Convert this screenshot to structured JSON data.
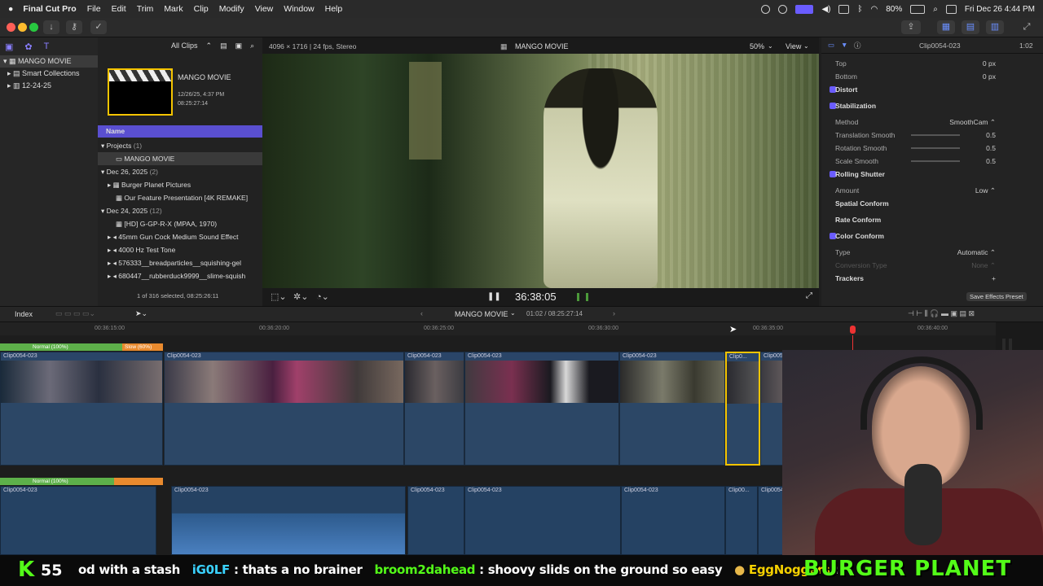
{
  "menubar": {
    "app_name": "Final Cut Pro",
    "items": [
      "File",
      "Edit",
      "Trim",
      "Mark",
      "Clip",
      "Modify",
      "View",
      "Window",
      "Help"
    ],
    "battery": "80%",
    "datetime": "Fri Dec 26  4:44 PM"
  },
  "sidebar": {
    "library": "MANGO MOVIE",
    "items": [
      "Smart Collections",
      "12-24-25"
    ]
  },
  "browser": {
    "filter": "All Clips",
    "project_name": "MANGO MOVIE",
    "project_date": "12/26/25, 4:37 PM",
    "project_duration": "08:25:27:14",
    "name_header": "Name",
    "groups": [
      {
        "label": "Projects",
        "count": "(1)"
      },
      {
        "label": "Dec 26, 2025",
        "count": "(2)"
      },
      {
        "label": "Dec 24, 2025",
        "count": "(12)"
      }
    ],
    "rows": [
      "MANGO MOVIE",
      "Burger Planet Pictures",
      "Our Feature Presentation [4K REMAKE]",
      "[HD] G-GP-R-X (MPAA, 1970)",
      "45mm Gun Cock Medium Sound Effect",
      "4000 Hz Test Tone",
      "576333__breadparticles__squishing-gel",
      "680447__rubberduck9999__slime-squish"
    ],
    "status": "1 of 316 selected, 08:25:26:11"
  },
  "viewer": {
    "format": "4096 × 1716 | 24 fps, Stereo",
    "title": "MANGO MOVIE",
    "zoom": "50%",
    "view_label": "View",
    "timecode": "36:38:05"
  },
  "inspector": {
    "clip_name": "Clip0054-023",
    "duration": "1:02",
    "rows": [
      {
        "label": "Top",
        "value": "0  px",
        "indent": true
      },
      {
        "label": "Bottom",
        "value": "0  px",
        "indent": true
      },
      {
        "label": "Distort",
        "value": "",
        "check": true
      },
      {
        "label": "Stabilization",
        "value": "",
        "check": true
      },
      {
        "label": "Method",
        "value": "SmoothCam ⌃",
        "indent": true
      },
      {
        "label": "Translation Smooth",
        "value": "0.5",
        "indent": true,
        "slider": true
      },
      {
        "label": "Rotation Smooth",
        "value": "0.5",
        "indent": true,
        "slider": true
      },
      {
        "label": "Scale Smooth",
        "value": "0.5",
        "indent": true,
        "slider": true
      },
      {
        "label": "Rolling Shutter",
        "value": "",
        "check": true
      },
      {
        "label": "Amount",
        "value": "Low ⌃",
        "indent": true
      },
      {
        "label": "Spatial Conform",
        "value": "",
        "check": false
      },
      {
        "label": "Rate Conform",
        "value": "",
        "check": false
      },
      {
        "label": "Color Conform",
        "value": "",
        "check": true
      },
      {
        "label": "Type",
        "value": "Automatic ⌃",
        "indent": true
      },
      {
        "label": "Conversion Type",
        "value": "None ⌃",
        "indent": true,
        "dim": true
      },
      {
        "label": "Trackers",
        "value": "+",
        "check": false
      }
    ],
    "save_preset": "Save Effects Preset"
  },
  "timeline": {
    "index_label": "Index",
    "project": "MANGO MOVIE",
    "position": "01:02 / 08:25:27:14",
    "ruler": [
      "00:36:15:00",
      "00:36:20:00",
      "00:36:25:00",
      "00:36:30:00",
      "00:36:35:00",
      "00:36:40:00"
    ],
    "speed_normal": "Normal (100%)",
    "speed_slow": "Slow (60%)",
    "clip_label": "Clip0054-023"
  },
  "ticker": {
    "logo": "K",
    "number": "55",
    "messages": [
      {
        "user": "",
        "text": "od with a stash"
      },
      {
        "user": "iG0LF",
        "text": ": thats a no brainer"
      },
      {
        "user": "broom2dahead",
        "text": ": shoovy slids on the ground so easy"
      },
      {
        "user": "EggNoggers",
        "text": ":"
      }
    ],
    "banner": "BURGER PLANET"
  }
}
